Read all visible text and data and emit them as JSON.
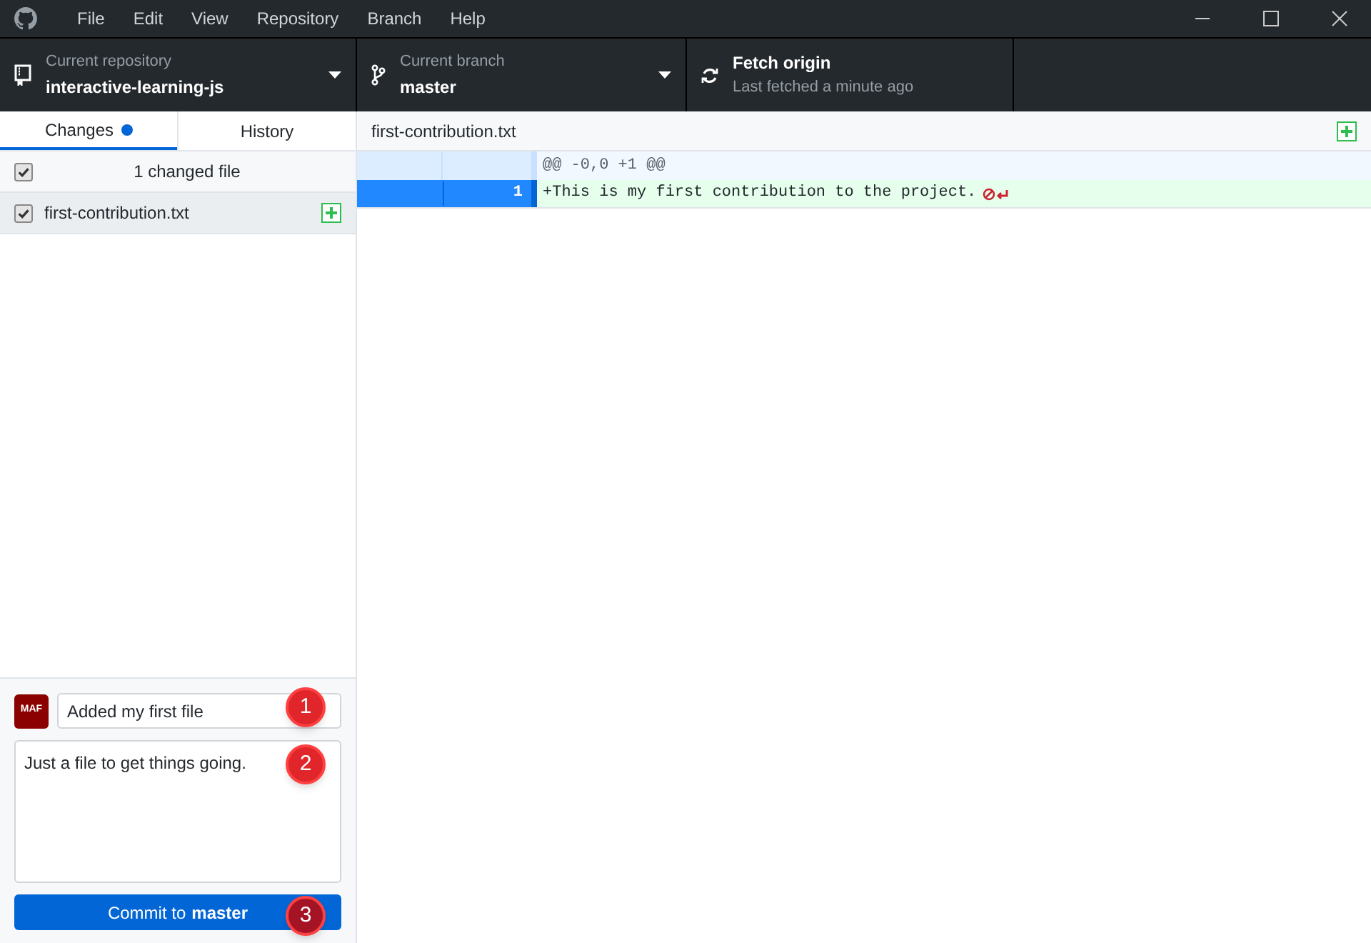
{
  "menu": [
    "File",
    "Edit",
    "View",
    "Repository",
    "Branch",
    "Help"
  ],
  "toolbar": {
    "repository": {
      "label": "Current repository",
      "value": "interactive-learning-js"
    },
    "branch": {
      "label": "Current branch",
      "value": "master"
    },
    "fetch": {
      "label": "Fetch origin",
      "sublabel": "Last fetched a minute ago"
    }
  },
  "tabs": [
    {
      "label": "Changes",
      "selected": true,
      "dot": true
    },
    {
      "label": "History",
      "selected": false,
      "dot": false
    }
  ],
  "changes_header": {
    "label": "1 changed file",
    "checked": true
  },
  "files": [
    {
      "name": "first-contribution.txt",
      "checked": true,
      "selected": true
    }
  ],
  "diff": {
    "file": "first-contribution.txt",
    "hunk": "@@ -0,0 +1 @@",
    "lines": [
      {
        "new": "1",
        "text": "+This is my first contribution to the project.",
        "selected": true
      }
    ]
  },
  "commit": {
    "avatar": "MAF",
    "summary": "Added my first file",
    "description": "Just a file to get things going.",
    "button_prefix": "Commit to",
    "button_branch": "master"
  },
  "callouts": [
    "1",
    "2",
    "3"
  ]
}
